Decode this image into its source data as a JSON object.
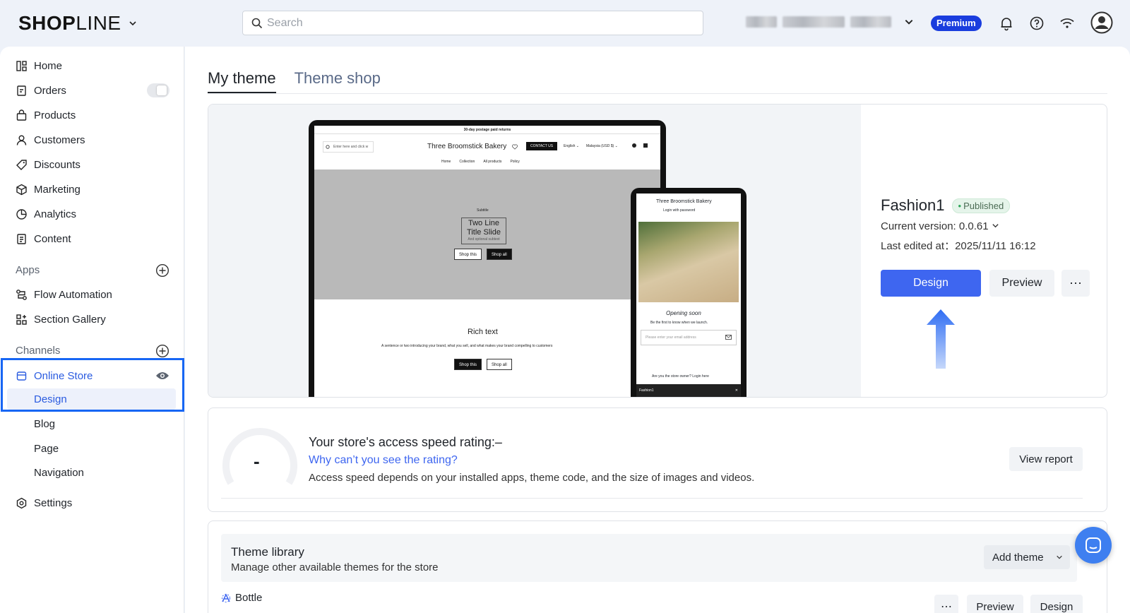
{
  "app": {
    "logo_bold": "SHOP",
    "logo_light": "LINE",
    "search_placeholder": "Search",
    "plan_badge": "Premium"
  },
  "sidebar": {
    "items": [
      {
        "label": "Home",
        "icon": "home-icon"
      },
      {
        "label": "Orders",
        "icon": "orders-icon"
      },
      {
        "label": "Products",
        "icon": "products-icon"
      },
      {
        "label": "Customers",
        "icon": "customers-icon"
      },
      {
        "label": "Discounts",
        "icon": "discounts-icon"
      },
      {
        "label": "Marketing",
        "icon": "marketing-icon"
      },
      {
        "label": "Analytics",
        "icon": "analytics-icon"
      },
      {
        "label": "Content",
        "icon": "content-icon"
      }
    ],
    "apps_header": "Apps",
    "apps": [
      {
        "label": "Flow Automation",
        "icon": "flow-automation-icon"
      },
      {
        "label": "Section Gallery",
        "icon": "section-gallery-icon"
      }
    ],
    "channels_header": "Channels",
    "online_store": "Online Store",
    "online_store_sub": [
      "Design",
      "Blog",
      "Page",
      "Navigation"
    ],
    "settings": "Settings"
  },
  "tabs": [
    {
      "label": "My theme",
      "active": true
    },
    {
      "label": "Theme shop",
      "active": false
    }
  ],
  "preview": {
    "laptop": {
      "announcement": "30-day postage paid returns",
      "search": "Enter here and click w",
      "store_name": "Three Broomstick Bakery",
      "contact": "CONTACT US",
      "lang": "English ⌄",
      "currency": "Malaysia (USD $) ⌄",
      "nav": [
        "Home",
        "Collection",
        "All products",
        "Policy"
      ],
      "hero_sub": "Subtitle",
      "hero_title_1": "Two Line",
      "hero_title_2": "Title Slide",
      "hero_caption": "And optional subtext",
      "btn_shop_this": "Shop this",
      "btn_shop_all": "Shop all",
      "rich_title": "Rich text",
      "rich_desc": "A sentence or two introducing your brand, what you sell, and what makes your brand compelling to customers"
    },
    "phone": {
      "store_name": "Three Broomstick Bakery",
      "login": "Login with password",
      "opening": "Opening soon",
      "first": "Be the first to know when we launch.",
      "email_placeholder": "Please enter your email address",
      "owner": "Are you the store owner? Login here",
      "footer": "Fashion1"
    }
  },
  "theme": {
    "name": "Fashion1",
    "status": "Published",
    "version_label": "Current version: 0.0.61",
    "edited_label": "Last edited at：2025/11/11 16:12",
    "design_btn": "Design",
    "preview_btn": "Preview",
    "more_btn": "⋯"
  },
  "speed": {
    "gauge_value": "-",
    "title": "Your store's access speed rating:–",
    "link": "Why can’t you see the rating?",
    "desc": "Access speed depends on your installed apps, theme code, and the size of images and videos.",
    "report_btn": "View report"
  },
  "library": {
    "title": "Theme library",
    "subtitle": "Manage other available themes for the store",
    "add_btn": "Add theme",
    "theme_name": "Bottle",
    "more_btn": "⋯",
    "preview_btn": "Preview",
    "design_btn": "Design"
  },
  "colors": {
    "accent": "#3e66f0",
    "highlight": "#1766f4",
    "premium": "#1a3dde"
  }
}
